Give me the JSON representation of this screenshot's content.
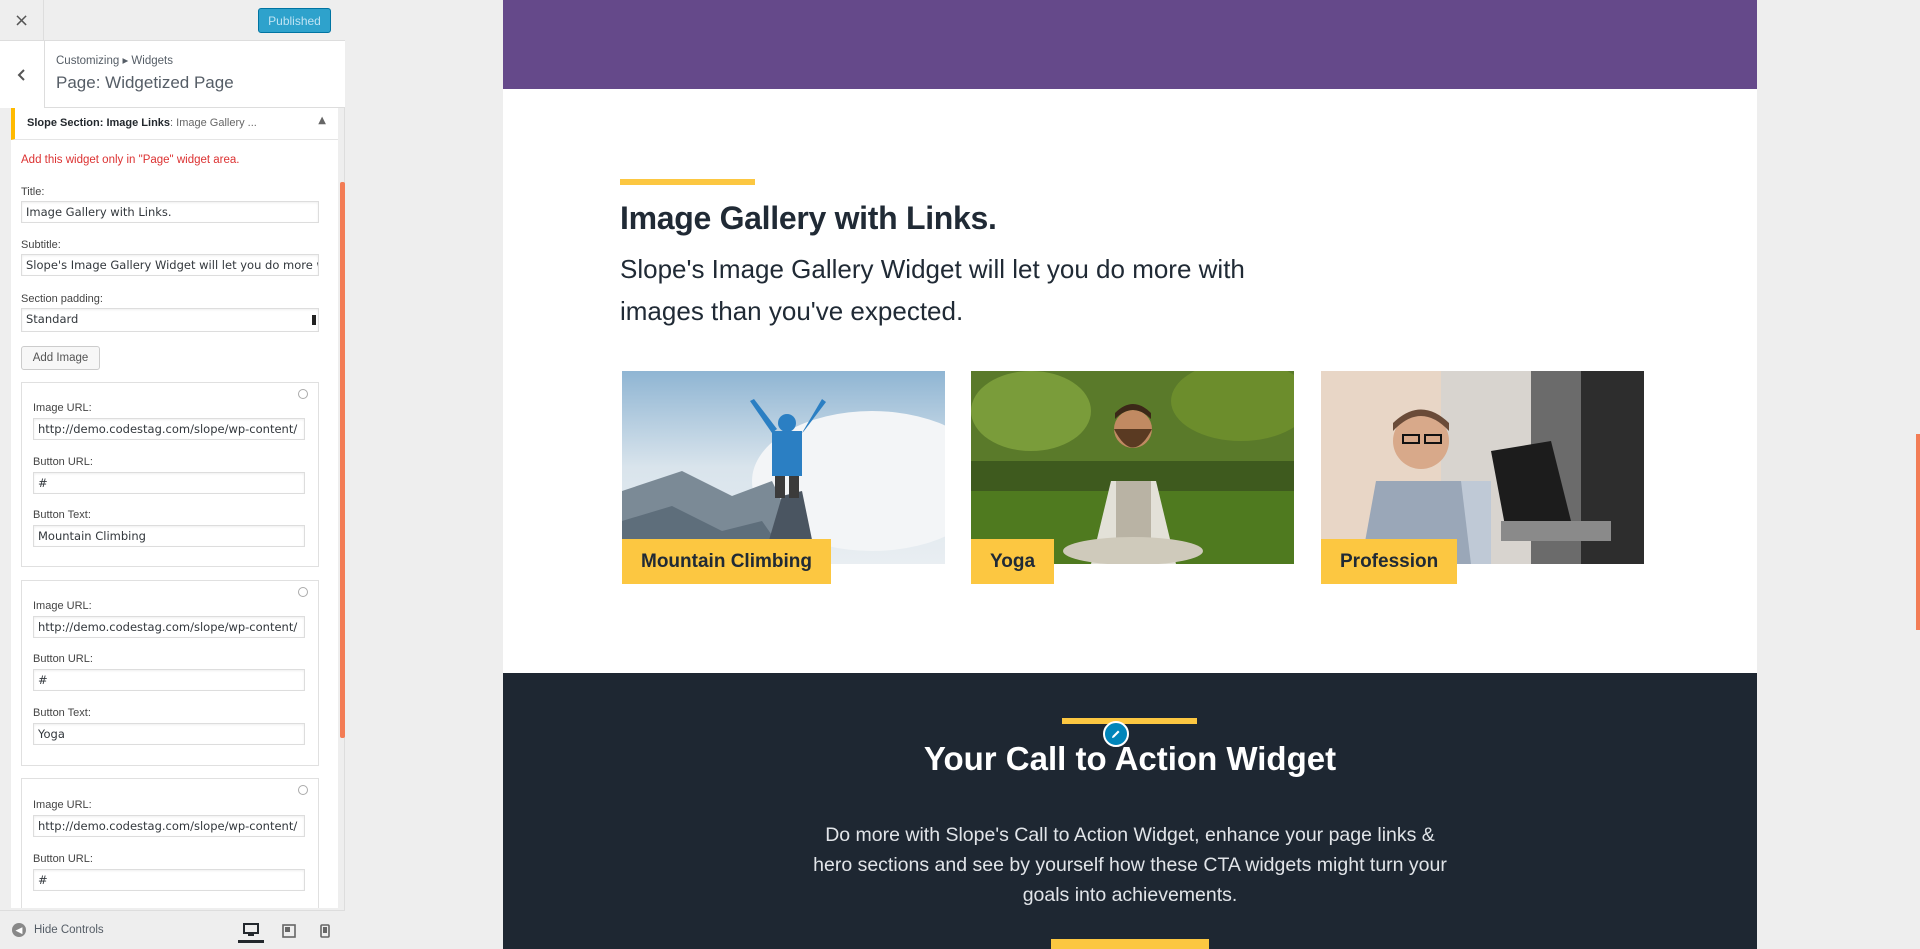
{
  "topbar": {
    "close_label": "×",
    "publish_label": "Published"
  },
  "panel_header": {
    "breadcrumb": "Customizing ▸ Widgets",
    "title": "Page: Widgetized Page"
  },
  "widget": {
    "title_bold": "Slope Section: Image Links",
    "title_rest": ": Image Gallery ...",
    "notice": "Add this widget only in \"Page\" widget area.",
    "fields": {
      "title_label": "Title:",
      "title_value": "Image Gallery with Links.",
      "subtitle_label": "Subtitle:",
      "subtitle_value": "Slope's Image Gallery Widget will let you do more w",
      "padding_label": "Section padding:",
      "padding_value": "Standard"
    },
    "add_image_label": "Add Image",
    "image_cards": [
      {
        "image_url_label": "Image URL:",
        "image_url": "http://demo.codestag.com/slope/wp-content/",
        "button_url_label": "Button URL:",
        "button_url": "#",
        "button_text_label": "Button Text:",
        "button_text": "Mountain Climbing"
      },
      {
        "image_url_label": "Image URL:",
        "image_url": "http://demo.codestag.com/slope/wp-content/",
        "button_url_label": "Button URL:",
        "button_url": "#",
        "button_text_label": "Button Text:",
        "button_text": "Yoga"
      },
      {
        "image_url_label": "Image URL:",
        "image_url": "http://demo.codestag.com/slope/wp-content/",
        "button_url_label": "Button URL:",
        "button_url": "#"
      }
    ]
  },
  "footer": {
    "hide_controls_label": "Hide Controls",
    "devices": [
      "desktop-icon",
      "tablet-icon",
      "mobile-icon"
    ]
  },
  "preview": {
    "gallery_title": "Image Gallery with Links.",
    "gallery_subtitle": "Slope's Image Gallery Widget will let you do more with images than you've expected.",
    "gallery_items": [
      {
        "label": "Mountain Climbing"
      },
      {
        "label": "Yoga"
      },
      {
        "label": "Profession"
      }
    ],
    "cta_title": "Your Call to Action Widget",
    "cta_text": "Do more with Slope's Call to Action Widget, enhance your page links & hero sections and see by yourself how these CTA widgets might turn your goals into achievements."
  },
  "colors": {
    "accent_yellow": "#fcc741",
    "purple_band": "#65498a",
    "cta_bg": "#1e2732",
    "publish_blue": "#2ea2cc",
    "scroll_orange": "#f37c55"
  }
}
